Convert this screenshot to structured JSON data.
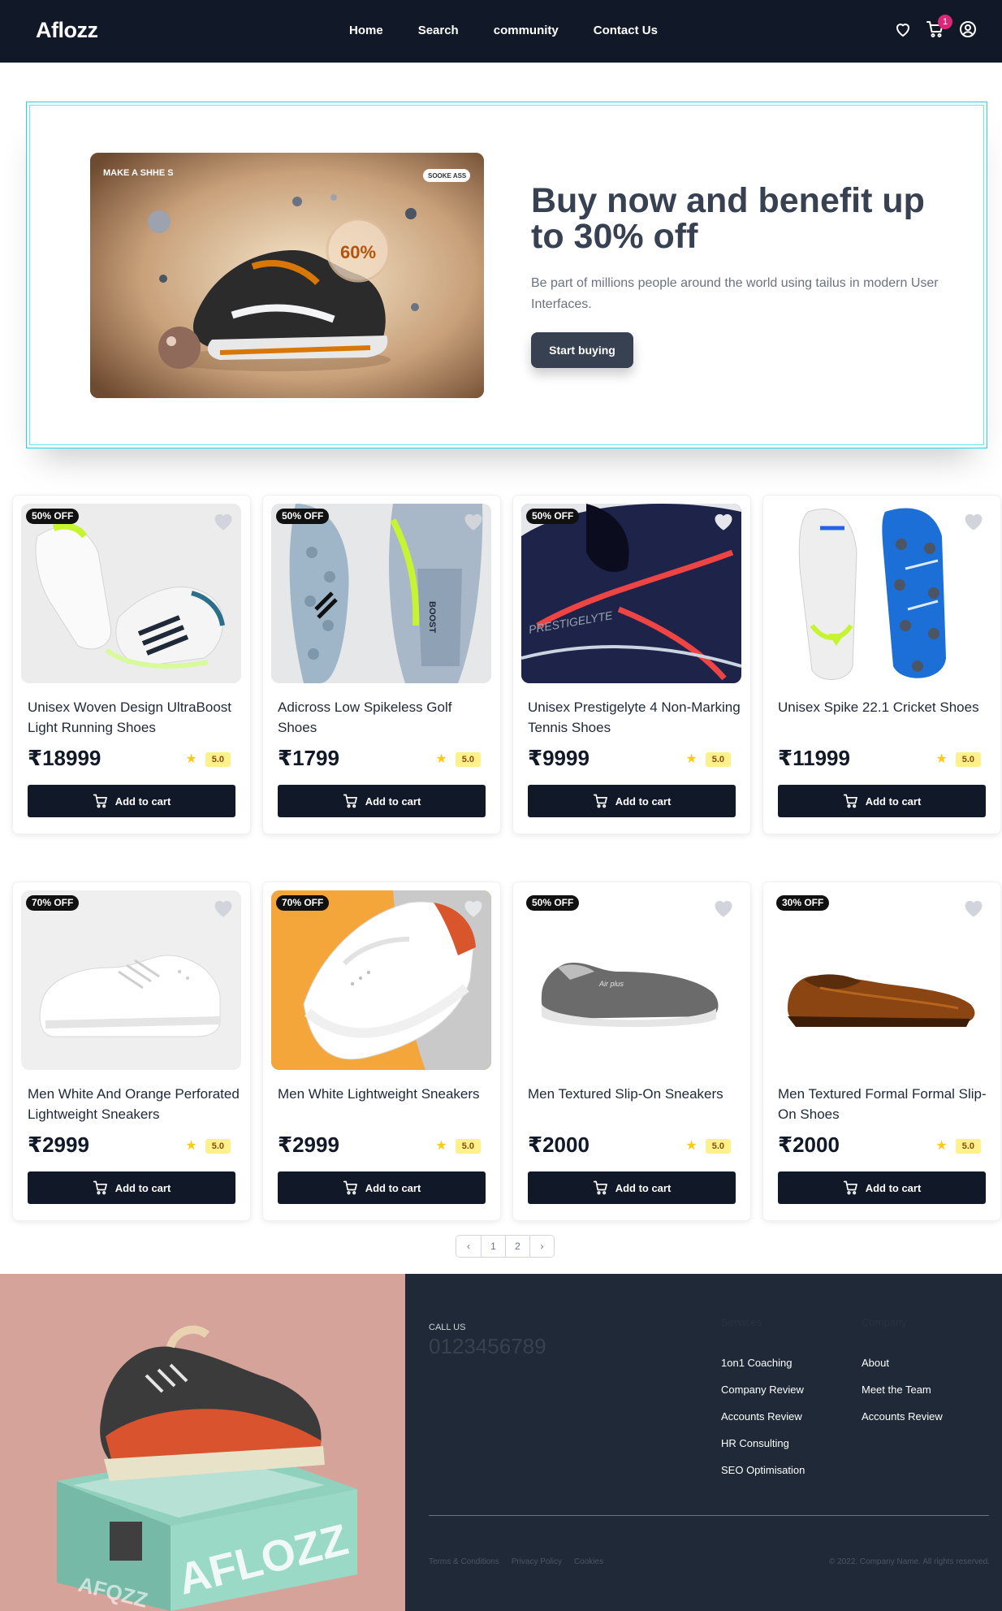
{
  "navbar": {
    "brand": "Aflozz",
    "links": [
      "Home",
      "Search",
      "community",
      "Contact Us"
    ],
    "cart_count": "1",
    "icons": [
      "heart-icon",
      "cart-icon",
      "user-icon"
    ]
  },
  "hero": {
    "image_text_left": "MAKE A\nSHHE S",
    "image_badge": "SOOKE ASS",
    "image_percent": "60%",
    "title": "Buy now and benefit up to 30% off",
    "text": "Be part of millions people around the world using tailus in modern User Interfaces.",
    "button": "Start buying"
  },
  "products": [
    {
      "discount": "50% OFF",
      "name": "Unisex Woven Design UltraBoost Light Running Shoes",
      "price": "₹18999",
      "rating": "5.0",
      "add_label": "Add to cart"
    },
    {
      "discount": "50% OFF",
      "name": "Adicross Low Spikeless Golf Shoes",
      "price": "₹1799",
      "rating": "5.0",
      "add_label": "Add to cart"
    },
    {
      "discount": "50% OFF",
      "name": "Unisex Prestigelyte 4 Non-Marking Tennis Shoes",
      "price": "₹9999",
      "rating": "5.0",
      "add_label": "Add to cart"
    },
    {
      "discount": "",
      "name": "Unisex Spike 22.1 Cricket Shoes",
      "price": "₹11999",
      "rating": "5.0",
      "add_label": "Add to cart"
    },
    {
      "discount": "70% OFF",
      "name": "Men White And Orange Perforated Lightweight Sneakers",
      "price": "₹2999",
      "rating": "5.0",
      "add_label": "Add to cart"
    },
    {
      "discount": "70% OFF",
      "name": "Men White Lightweight Sneakers",
      "price": "₹2999",
      "rating": "5.0",
      "add_label": "Add to cart"
    },
    {
      "discount": "50% OFF",
      "name": "Men Textured Slip-On Sneakers",
      "price": "₹2000",
      "rating": "5.0",
      "add_label": "Add to cart"
    },
    {
      "discount": "30% OFF",
      "name": "Men Textured Formal Formal Slip-On Shoes",
      "price": "₹2000",
      "rating": "5.0",
      "add_label": "Add to cart"
    }
  ],
  "pagination": {
    "prev": "‹",
    "pages": [
      "1",
      "2"
    ],
    "next": "›"
  },
  "footer": {
    "call_label": "CALL US",
    "call_number": "0123456789",
    "services_title": "Services",
    "services": [
      "1on1 Coaching",
      "Company Review",
      "Accounts Review",
      "HR Consulting",
      "SEO Optimisation"
    ],
    "company_title": "Company",
    "company": [
      "About",
      "Meet the Team",
      "Accounts Review"
    ],
    "legal": [
      "Terms & Conditions",
      "Privacy Policy",
      "Cookies"
    ],
    "copyright": "© 2022. Company Name. All rights reserved.",
    "box_brand": "AFLOZZ"
  },
  "colors": {
    "nav_bg": "#111827",
    "hero_border": "#22d3ee",
    "button_dark": "#111827",
    "badge_pink": "#db2777",
    "rating_bg": "#fef08a",
    "footer_bg": "#1f2937"
  }
}
